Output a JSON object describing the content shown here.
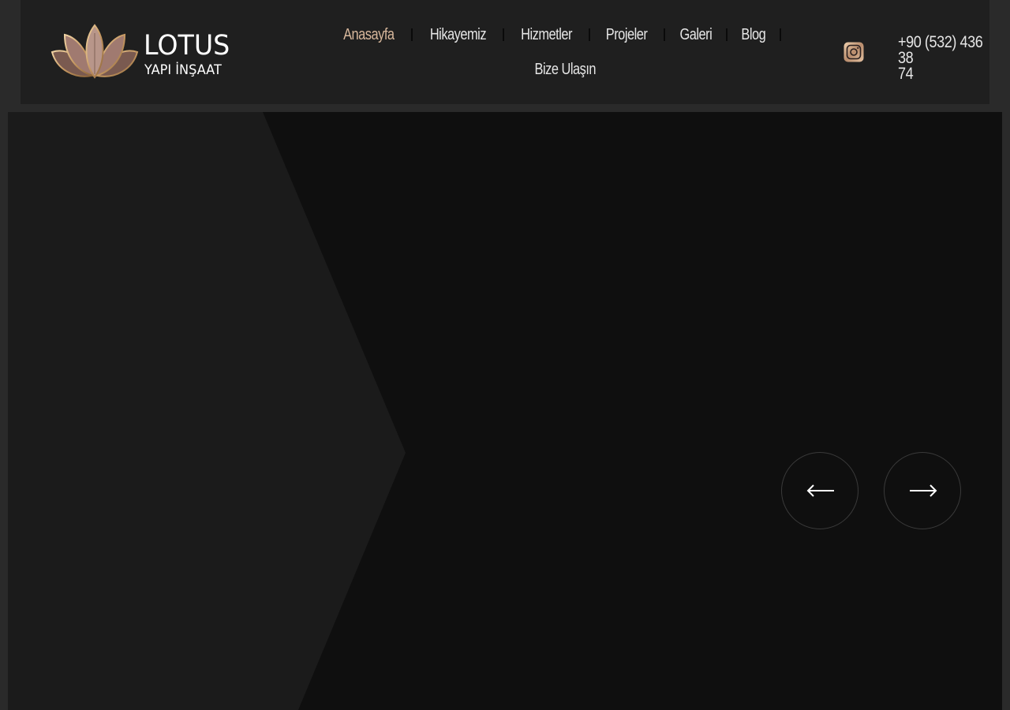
{
  "brand": {
    "name": "LOTUS",
    "tagline": "YAPI İNŞAAT",
    "accent_color": "#d8b89c"
  },
  "nav": {
    "items": [
      {
        "label": "Anasayfa",
        "active": true
      },
      {
        "label": "Hikayemiz",
        "active": false
      },
      {
        "label": "Hizmetler",
        "active": false
      },
      {
        "label": "Projeler",
        "active": false
      },
      {
        "label": "Galeri",
        "active": false
      },
      {
        "label": "Blog",
        "active": false
      },
      {
        "label": "Bize Ulaşın",
        "active": false
      }
    ]
  },
  "header": {
    "social_icon": "instagram-icon",
    "phone_line1": "+90 (532) 436 38",
    "phone_line2": "74"
  },
  "slider": {
    "prev_icon": "arrow-left-icon",
    "next_icon": "arrow-right-icon"
  },
  "colors": {
    "page_bg": "#2a2a2a",
    "header_bg": "#1f1f1f",
    "hero_bg": "#0f0f0f",
    "hero_panel": "#1b1b1b"
  }
}
